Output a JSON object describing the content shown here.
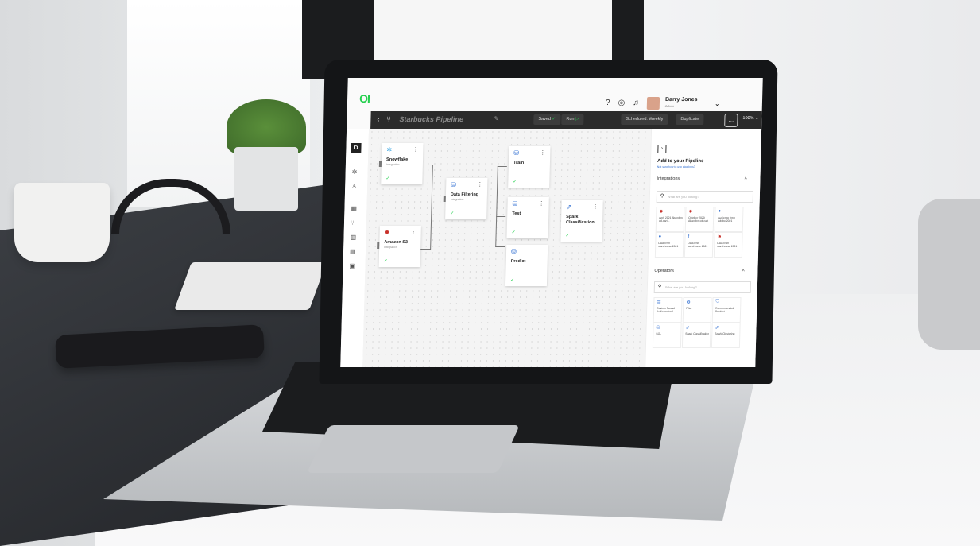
{
  "app": {
    "logo": "OI",
    "user": {
      "name": "Barry Jones",
      "role": "Admin"
    },
    "topbar_icons": [
      "help-icon",
      "eye-off-icon",
      "bell-icon"
    ]
  },
  "toolbar": {
    "pipeline_name": "Starbucks Pipeline",
    "saved_label": "Saved",
    "run_label": "Run",
    "schedule_label": "Scheduled: Weekly",
    "duplicate_label": "Duplicate",
    "zoom": "100%"
  },
  "leftbar": {
    "badge": "D"
  },
  "nodes": [
    {
      "name": "Snowflake",
      "type": "Integration",
      "icon": "snowflake-icon",
      "color": "#2d9fe0"
    },
    {
      "name": "Amazon S3",
      "type": "Integration",
      "icon": "aws-icon",
      "color": "#c8302a"
    },
    {
      "name": "Data Filtering",
      "type": "Integration",
      "icon": "database-icon",
      "color": "#2a6ad0"
    },
    {
      "name": "Train",
      "type": "",
      "icon": "database-icon",
      "color": "#2a6ad0"
    },
    {
      "name": "Test",
      "type": "",
      "icon": "database-icon",
      "color": "#2a6ad0"
    },
    {
      "name": "Predict",
      "type": "",
      "icon": "database-icon",
      "color": "#2a6ad0"
    },
    {
      "name": "Spark Classification",
      "type": "",
      "icon": "chart-icon",
      "color": "#2a6ad0"
    }
  ],
  "panel": {
    "title": "Add to your Pipeline",
    "link": "Not sure how to use pipelines?",
    "integrations_label": "Integrations",
    "integrations_search": "What are you looking?",
    "integrations": [
      "April 2021 Abandon ed-cart...",
      "October 2020 Abandon ed-cart",
      "Audience from Adobe 2021",
      "Data from warehouse 2021",
      "Data from warehouse 2021",
      "Data from warehouse 2021"
    ],
    "operators_label": "Operators",
    "operators_search": "What are you looking?",
    "operators": [
      "Custom Funnel Audience tool",
      "Filter",
      "Recommended Product",
      "SQL",
      "Spark Classification",
      "Spark Clustering"
    ]
  }
}
